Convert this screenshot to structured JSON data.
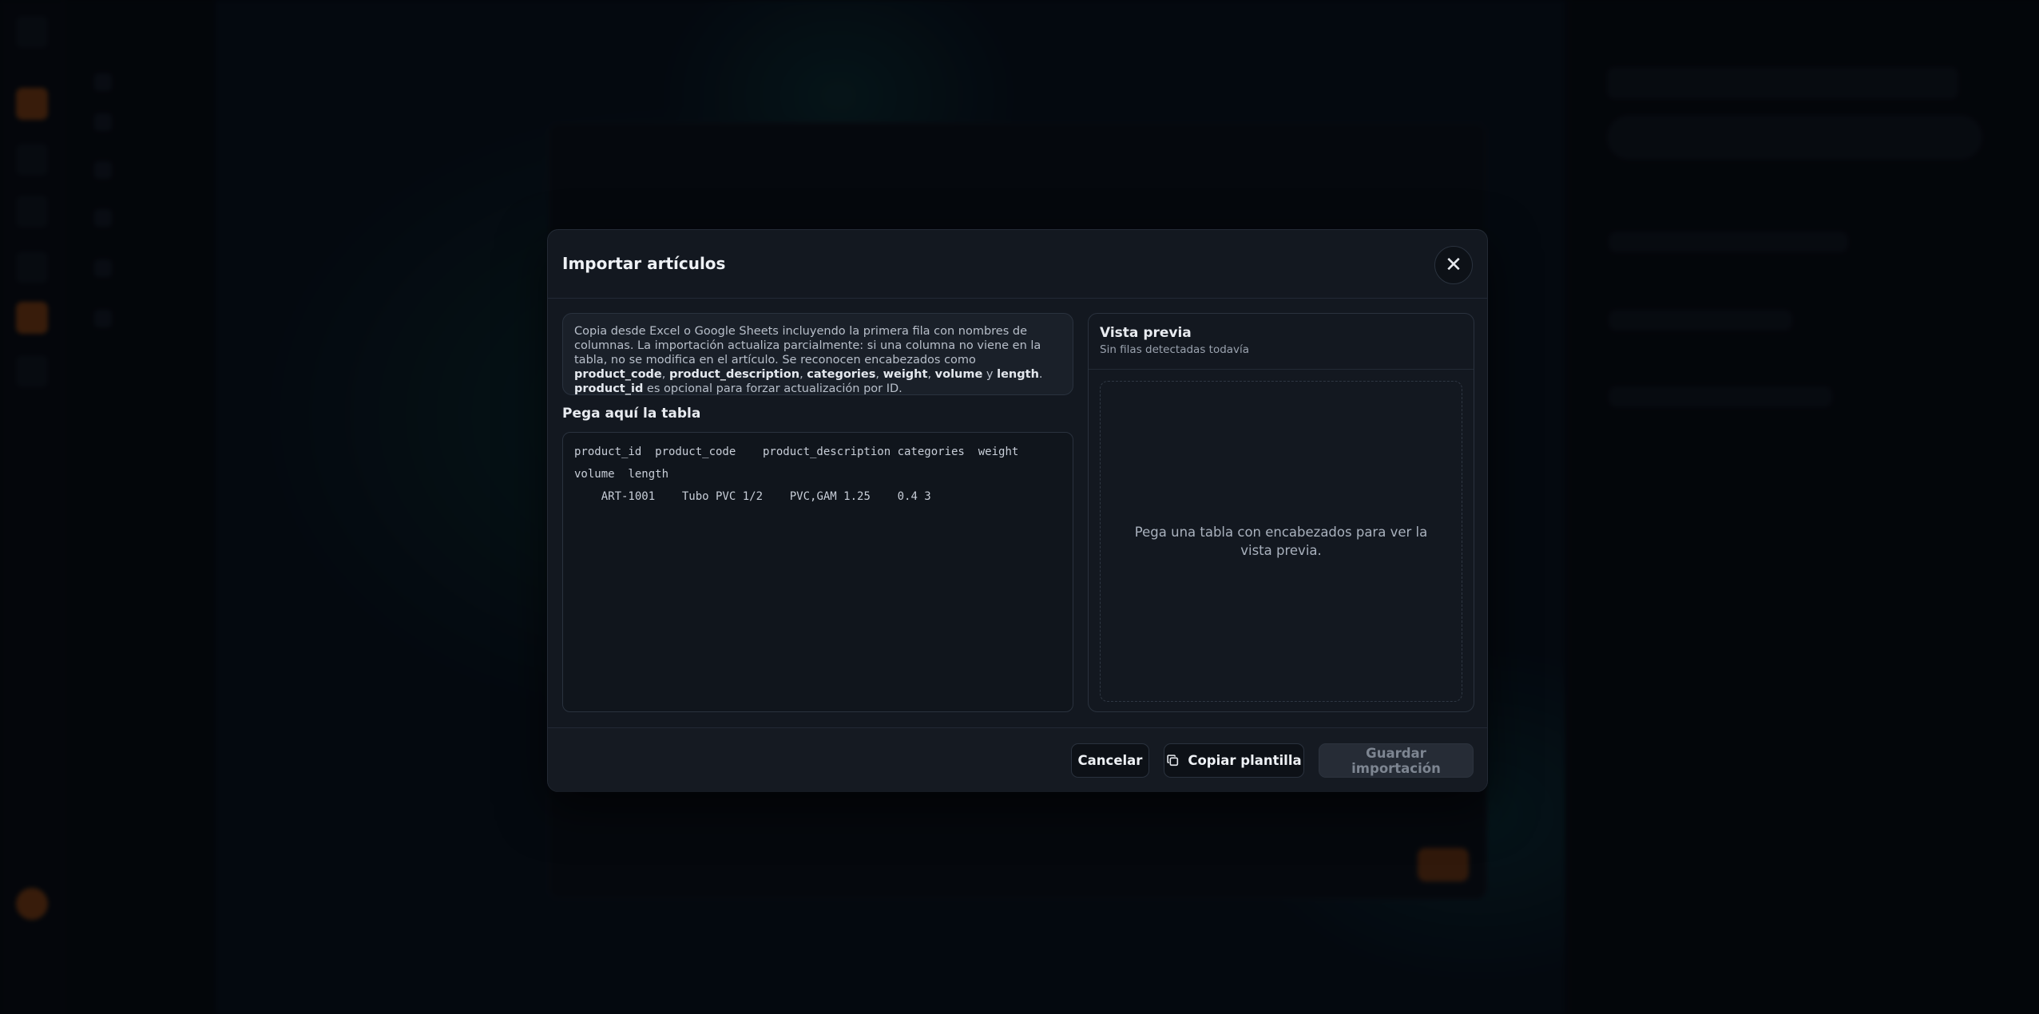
{
  "dialog": {
    "title": "Importar artículos",
    "close_icon": "close-icon",
    "info": {
      "part1": "Copia desde Excel o Google Sheets incluyendo la primera fila con nombres de columnas. La importación actualiza parcialmente: si una columna no viene en la tabla, no se modifica en el artículo. Se reconocen encabezados como ",
      "h1": "product_code",
      "sep1": ", ",
      "h2": "product_description",
      "sep2": ", ",
      "h3": "categories",
      "sep3": ", ",
      "h4": "weight",
      "sep4": ", ",
      "h5": "volume",
      "sep5": " y ",
      "h6": "length",
      "sep6": ". ",
      "h7": "product_id",
      "part2": " es opcional para forzar actualización por ID."
    },
    "paste_label": "Pega aquí la tabla",
    "paste_value": "product_id  product_code    product_description categories  weight  volume  length\n    ART-1001    Tubo PVC 1/2    PVC,GAM 1.25    0.4 3",
    "preview": {
      "title": "Vista previa",
      "subtitle": "Sin filas detectadas todavía",
      "empty_message": "Pega una tabla con encabezados para ver la vista previa."
    },
    "footer": {
      "cancel_label": "Cancelar",
      "copy_label": "Copiar plantilla",
      "copy_icon": "copy-icon",
      "save_label": "Guardar importación"
    }
  }
}
